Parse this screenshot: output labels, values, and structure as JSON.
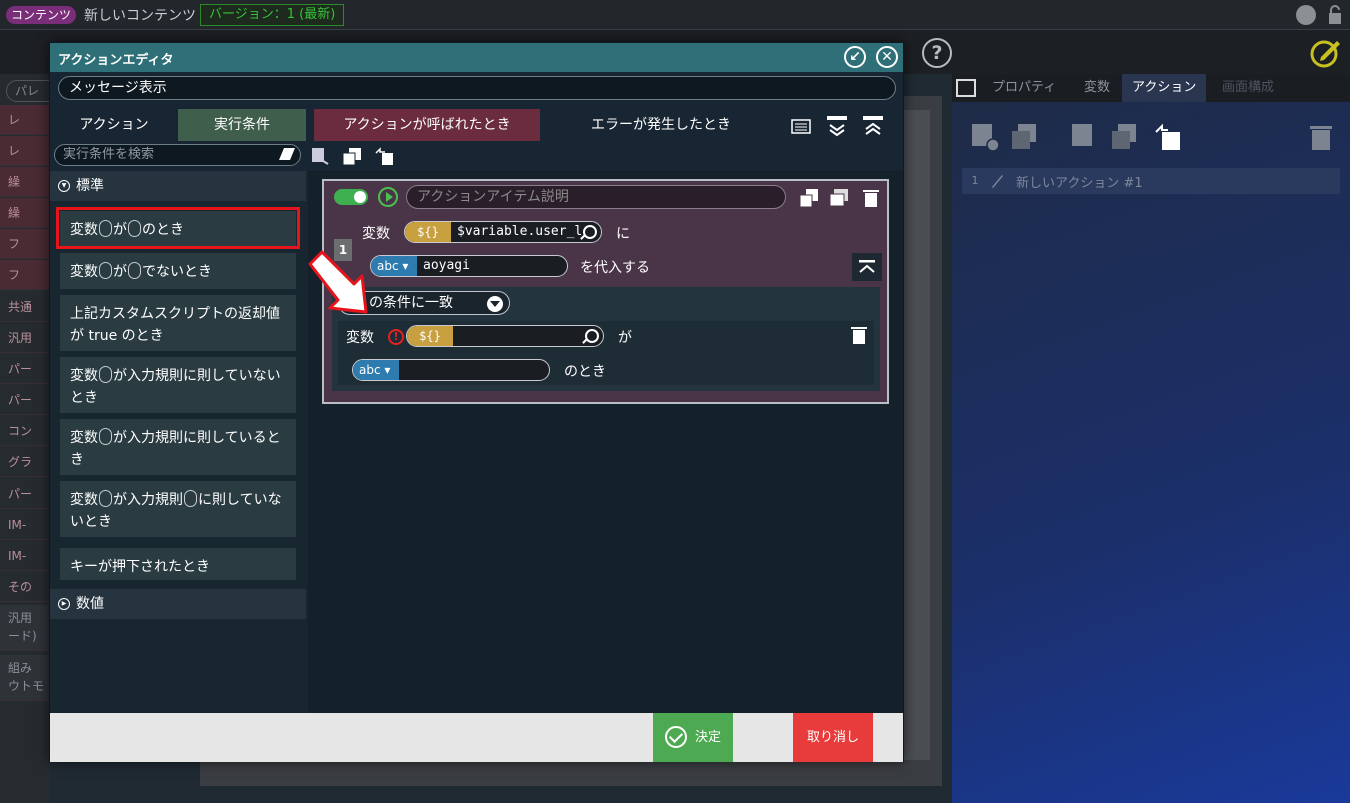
{
  "topbar": {
    "content_badge": "コンテンツ",
    "title": "新しいコンテンツ",
    "version": "バージョン：1 (最新)"
  },
  "palette": {
    "search_placeholder": "パレ",
    "items": [
      "レ",
      "レ",
      "繰",
      "繰",
      "フ",
      "フ",
      "共通",
      "汎用",
      "パー",
      "パー",
      "コン",
      "グラ",
      "パー",
      "IM-",
      "IM-",
      "その",
      "汎用\nード)",
      "組み\nウトモ"
    ]
  },
  "right_panel": {
    "tabs": [
      "プロパティ",
      "変数",
      "アクション",
      "画面構成"
    ],
    "active_tab": "アクション",
    "action_list": [
      {
        "num": "1",
        "label": "新しいアクション #1"
      }
    ]
  },
  "dialog": {
    "title": "アクションエディタ",
    "action_name": "メッセージ表示",
    "tabs": [
      "アクション",
      "実行条件",
      "アクションが呼ばれたとき",
      "エラーが発生したとき"
    ],
    "search_placeholder": "実行条件を検索",
    "categories": {
      "standard": "標準",
      "numeric": "数値"
    },
    "conditions": [
      {
        "parts": [
          "変数",
          "ring",
          "が",
          "ring",
          "のとき"
        ]
      },
      {
        "parts": [
          "変数",
          "ring",
          "が",
          "ring",
          "でないとき"
        ]
      },
      {
        "parts": [
          "上記カスタムスクリプトの返却値が true のとき"
        ]
      },
      {
        "parts": [
          "変数",
          "ring",
          "が入力規則に則していないとき"
        ]
      },
      {
        "parts": [
          "変数",
          "ring",
          "が入力規則に則しているとき"
        ]
      },
      {
        "parts": [
          "変数",
          "ring",
          "が入力規則",
          "ring",
          "に則していないとき"
        ]
      },
      {
        "parts": [
          "キーが押下されたとき"
        ]
      }
    ],
    "card": {
      "desc_placeholder": "アクションアイテム説明",
      "row_num": "1",
      "var_label": "変数",
      "var_tag": "${}",
      "var_value": "$variable.user_l",
      "ni": "に",
      "abc_tag": "abc",
      "abc_value": "aoyagi",
      "assign_label": "を代入する",
      "match_label": "この条件に一致",
      "cond_var_label": "変数",
      "cond_var_tag": "${}",
      "ga": "が",
      "cond_abc_tag": "abc",
      "notoki": "のとき"
    },
    "footer": {
      "ok": "決定",
      "cancel": "取り消し"
    }
  }
}
